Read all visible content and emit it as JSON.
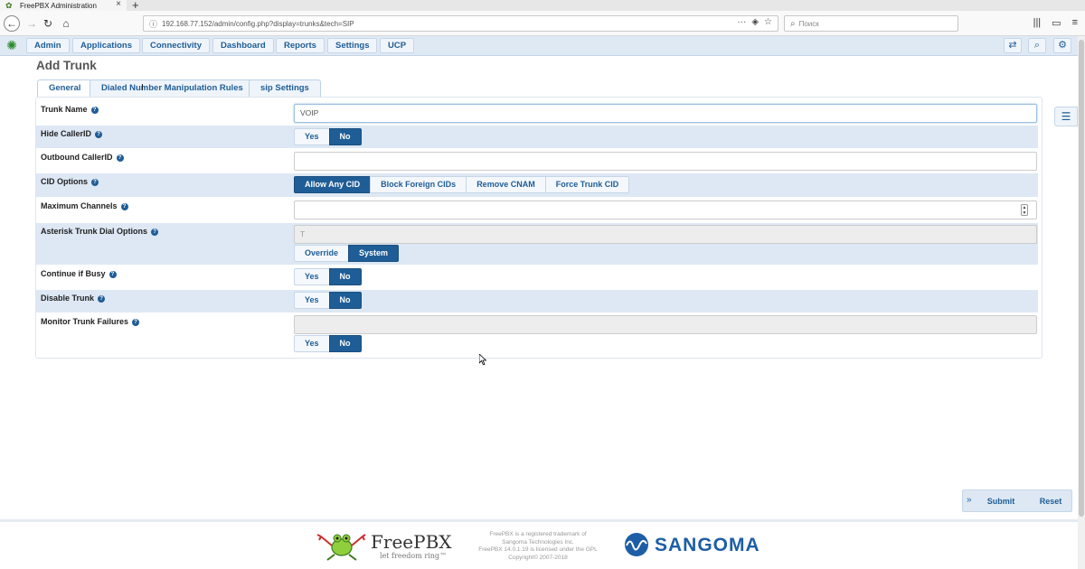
{
  "browser": {
    "tab_title": "FreePBX Administration",
    "url": "192.168.77.152/admin/config.php?display=trunks&tech=SIP",
    "search_placeholder": "Поиск"
  },
  "nav": {
    "menus": [
      "Admin",
      "Applications",
      "Connectivity",
      "Dashboard",
      "Reports",
      "Settings",
      "UCP"
    ]
  },
  "page": {
    "title": "Add Trunk",
    "tabs": [
      "General",
      "Dialed Number Manipulation Rules",
      "sip Settings"
    ]
  },
  "form": {
    "trunk_name_label": "Trunk Name",
    "trunk_name_value": "VOIP",
    "hide_callerid_label": "Hide CallerID",
    "outbound_callerid_label": "Outbound CallerID",
    "cid_options_label": "CID Options",
    "cid_options": [
      "Allow Any CID",
      "Block Foreign CIDs",
      "Remove CNAM",
      "Force Trunk CID"
    ],
    "max_channels_label": "Maximum Channels",
    "dial_options_label": "Asterisk Trunk Dial Options",
    "dial_options_value": "T",
    "override_label": "Override",
    "system_label": "System",
    "continue_busy_label": "Continue if Busy",
    "disable_trunk_label": "Disable Trunk",
    "monitor_failures_label": "Monitor Trunk Failures",
    "yes": "Yes",
    "no": "No"
  },
  "actions": {
    "submit": "Submit",
    "reset": "Reset"
  },
  "footer": {
    "brand": "FreePBX",
    "tagline": "let freedom ring™",
    "legal_1": "FreePBX is a registered trademark of",
    "legal_2": "Sangoma Technologies Inc.",
    "legal_3": "FreePBX 14.0.1.19 is licensed under the GPL",
    "legal_4": "Copyright© 2007-2018",
    "sangoma": "SANGOMA"
  }
}
